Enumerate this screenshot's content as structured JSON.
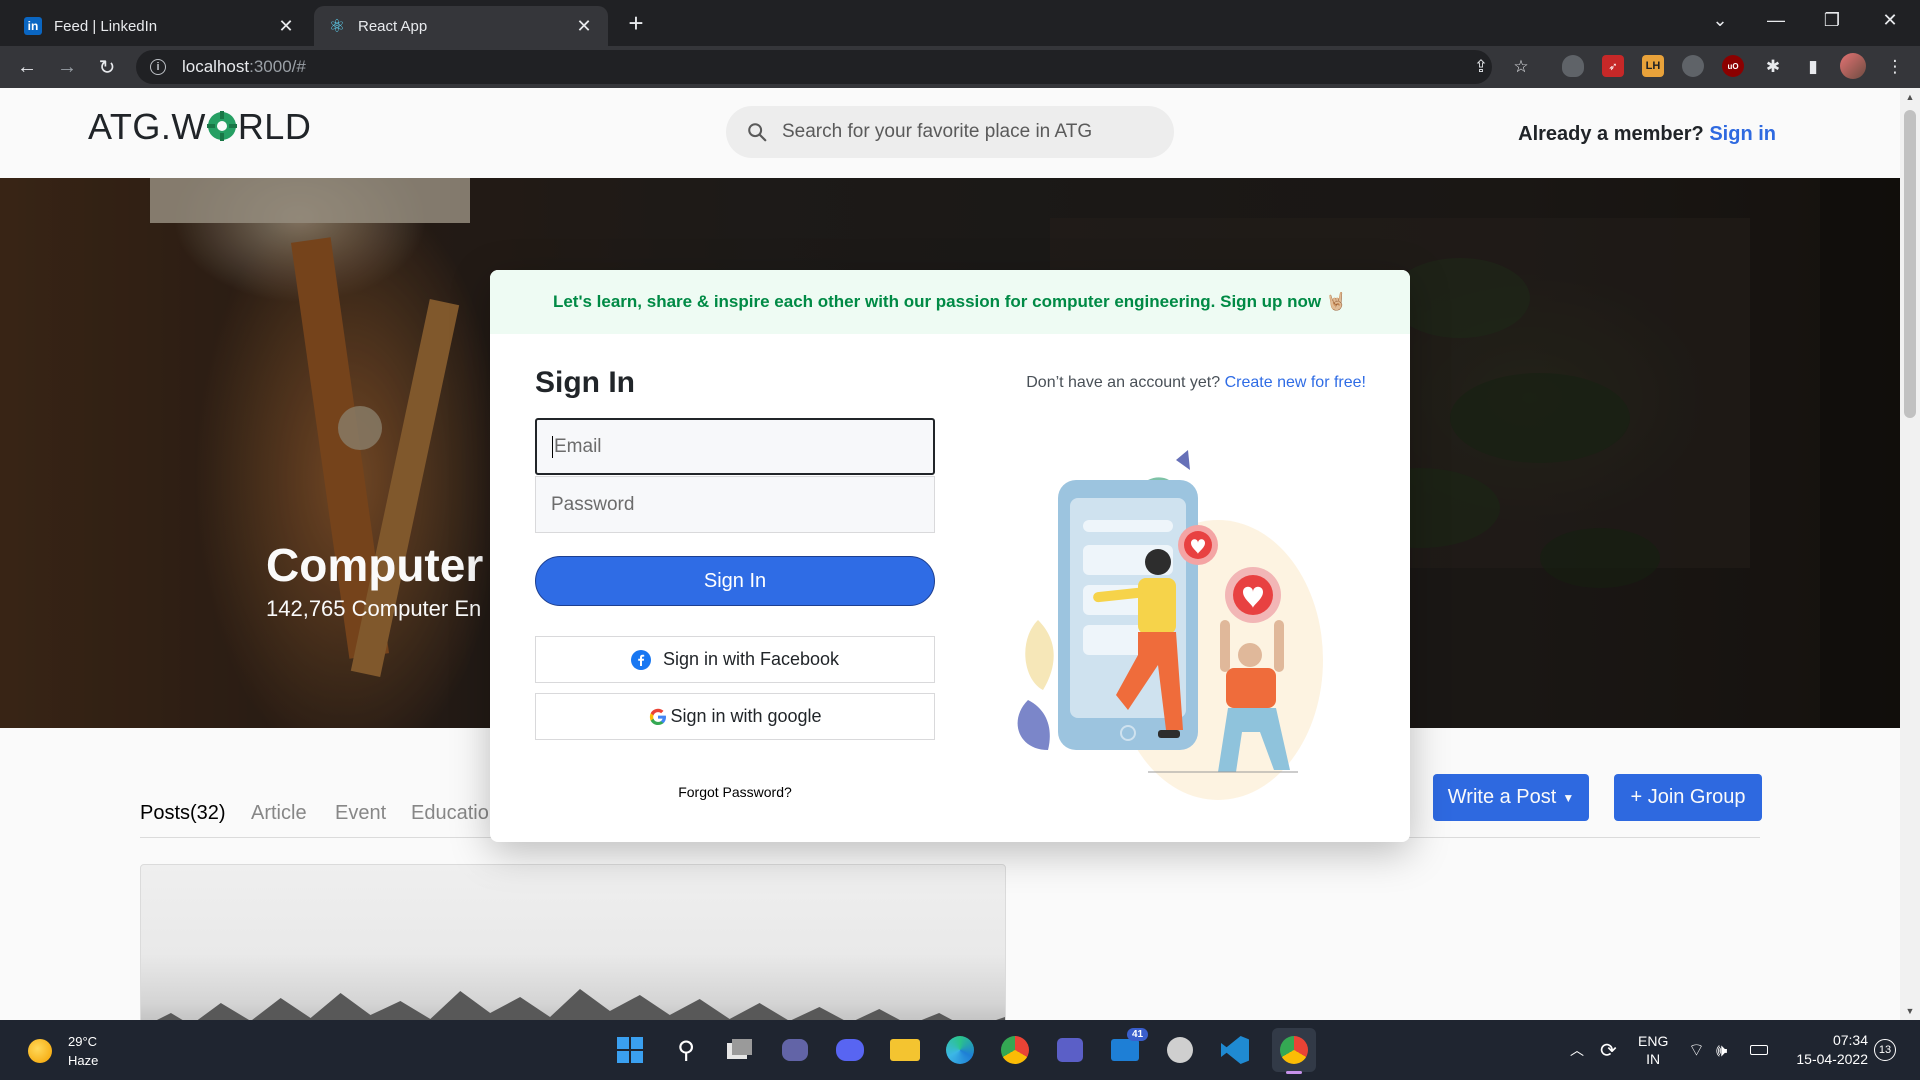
{
  "browser": {
    "tabs": [
      {
        "title": "Feed | LinkedIn",
        "favicon": "linkedin-icon",
        "active": false
      },
      {
        "title": "React App",
        "favicon": "react-icon",
        "active": true
      }
    ],
    "new_tab": "+",
    "url_host": "localhost",
    "url_path": ":3000/#",
    "extensions": [
      "uBlock",
      "LH"
    ]
  },
  "header": {
    "logo_prefix": "ATG.W",
    "logo_suffix": "RLD",
    "search_placeholder": "Search for your favorite place in ATG",
    "member_text": "Already a member?",
    "member_link": "Sign in"
  },
  "hero": {
    "title": "Computer E",
    "subtitle": "142,765 Computer En"
  },
  "page_tabs": [
    {
      "label": "Posts(32)",
      "active": true
    },
    {
      "label": "Article",
      "active": false
    },
    {
      "label": "Event",
      "active": false
    },
    {
      "label": "Educatio",
      "active": false
    }
  ],
  "actions": {
    "write_post": "Write a Post",
    "join_group": "+ Join Group"
  },
  "modal": {
    "banner": "Let's learn, share & inspire each other with our passion for computer engineering. Sign up now 🤘🏼",
    "title": "Sign In",
    "no_account": "Don’t have an account yet?",
    "create_link": "Create new for free!",
    "email_placeholder": "Email",
    "password_placeholder": "Password",
    "signin_button": "Sign In",
    "facebook_button": "Sign in with Facebook",
    "google_button": "Sign in with google",
    "forgot": "Forgot Password?"
  },
  "taskbar": {
    "temperature": "29°C",
    "weather": "Haze",
    "lang1": "ENG",
    "lang2": "IN",
    "time": "07:34",
    "date": "15-04-2022",
    "notif_count": "13",
    "mail_badge": "41"
  },
  "colors": {
    "accent": "#2f6ce5",
    "brand_green": "#27a365",
    "banner_text": "#008a45",
    "banner_bg": "#eefbf3"
  }
}
